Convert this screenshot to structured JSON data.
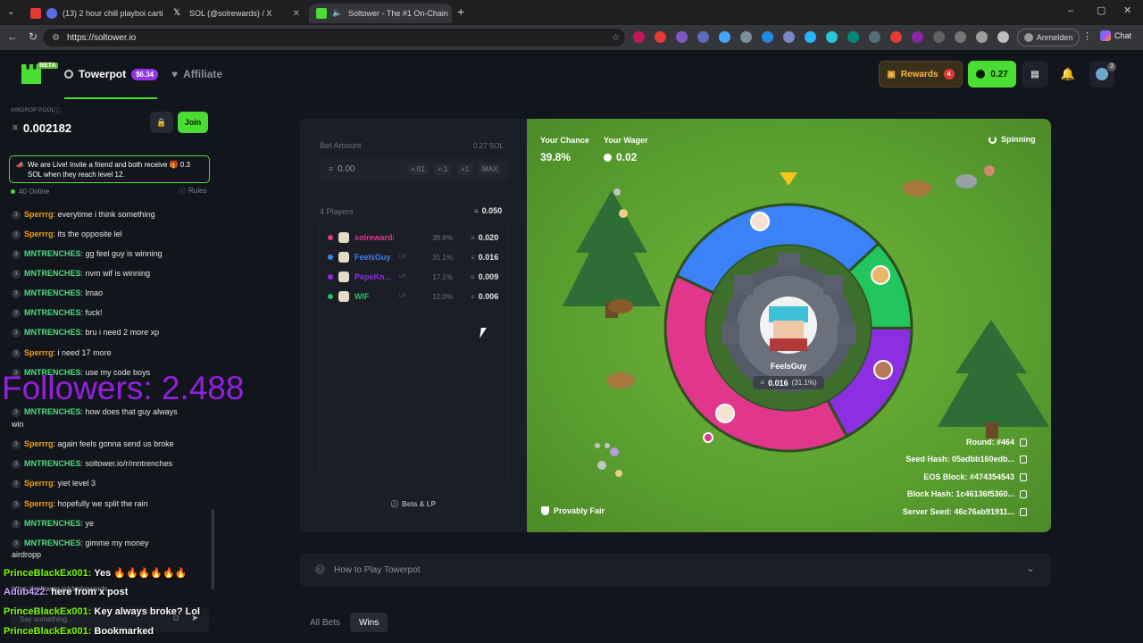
{
  "browser": {
    "tabs": [
      {
        "title": "(13) 2 hour chill playboi carti"
      },
      {
        "title": "SOL (@solrewards) / X"
      },
      {
        "title": "Soltower - The #1 On-Chain"
      }
    ],
    "url": "https://soltower.io",
    "profile_label": "Anmelden",
    "chat_label": "Chat"
  },
  "nav": {
    "beta": "BETA",
    "towerpot_label": "Towerpot",
    "towerpot_badge": "$6.34",
    "affiliate_label": "Affiliate",
    "rewards_label": "Rewards",
    "rewards_count": "4",
    "balance": "0.27",
    "notif_count": "3"
  },
  "sidebar": {
    "airdrop_label": "AIRDROP POOL",
    "airdrop_value": "0.002182",
    "join_label": "Join",
    "announcement": "We are Live! Invite a friend and both receive 🎁 0.3 SOL when they reach level 12.",
    "online": "40 Online",
    "rules": "Rules",
    "chat": [
      {
        "level": "3",
        "user": "Sperrrg",
        "color": "orange",
        "text": "everytime i think something"
      },
      {
        "level": "3",
        "user": "Sperrrg",
        "color": "orange",
        "text": "its the opposite lel"
      },
      {
        "level": "3",
        "user": "MNTRENCHES",
        "color": "green",
        "text": "gg feel guy is winning"
      },
      {
        "level": "3",
        "user": "MNTRENCHES",
        "color": "green",
        "text": "nvm wif is winning"
      },
      {
        "level": "3",
        "user": "MNTRENCHES",
        "color": "green",
        "text": "lmao"
      },
      {
        "level": "3",
        "user": "MNTRENCHES",
        "color": "green",
        "text": "fuck!"
      },
      {
        "level": "3",
        "user": "MNTRENCHES",
        "color": "green",
        "text": "bru i need 2 more xp"
      },
      {
        "level": "3",
        "user": "Sperrrg",
        "color": "orange",
        "text": "i need 17 more"
      },
      {
        "level": "3",
        "user": "MNTRENCHES",
        "color": "green",
        "text": "use my code boys"
      },
      {
        "level": "3",
        "user": "MNTRENCHES",
        "color": "green",
        "text": "how does that guy always"
      },
      {
        "level": "3",
        "user": "Sperrrg",
        "color": "orange",
        "text": "again feels gonna send us broke"
      },
      {
        "level": "3",
        "user": "MNTRENCHES",
        "color": "green",
        "text": "soltower.io/r/mntrenches"
      },
      {
        "level": "3",
        "user": "Sperrrg",
        "color": "orange",
        "text": "yiet level 3"
      },
      {
        "level": "3",
        "user": "Sperrrg",
        "color": "orange",
        "text": "hopefully we split the rain"
      },
      {
        "level": "3",
        "user": "MNTRENCHES",
        "color": "green",
        "text": "ye"
      },
      {
        "level": "3",
        "user": "MNTRENCHES",
        "color": "green",
        "text": "gimme my money"
      }
    ],
    "wrap_win": "win",
    "wrap_airdrop": "airdropp",
    "chat_link": "https://soltower.io/r/solrewards",
    "chat_placeholder": "Say something..."
  },
  "overlay": {
    "followers": "Followers: 2.488",
    "lines": [
      {
        "user": "PrinceBlackEx001:",
        "text": "Yes 🔥🔥🔥🔥🔥🔥"
      },
      {
        "user": "Adub422:",
        "text": "here from x post"
      },
      {
        "user": "PrinceBlackEx001:",
        "text": "Key always broke? Lol"
      },
      {
        "user": "PrinceBlackEx001:",
        "text": "Bookmarked"
      }
    ]
  },
  "bet": {
    "amount_label": "Bet Amount",
    "balance": "0.27 SOL",
    "amount_value": "0.00",
    "btn_p001": "+.01",
    "btn_p1a": "+.1",
    "btn_p1b": "+1",
    "btn_max": "MAX",
    "players_label": "4 Players",
    "pot": "0.050",
    "players": [
      {
        "name": "solrewards",
        "pct": "39.8%",
        "amount": "0.020",
        "color": "#e0368b",
        "tag": ""
      },
      {
        "name": "FeelsGuy",
        "pct": "31.1%",
        "amount": "0.016",
        "color": "#3b82f6",
        "tag": "LP"
      },
      {
        "name": "PepeKn...",
        "pct": "17.1%",
        "amount": "0.009",
        "color": "#8b2fe0",
        "tag": "LP"
      },
      {
        "name": "WIF",
        "pct": "12.0%",
        "amount": "0.006",
        "color": "#22c55e",
        "tag": "LP"
      }
    ],
    "footer": "Beta & LP"
  },
  "game": {
    "chance_label": "Your Chance",
    "chance_value": "39.8%",
    "wager_label": "Your Wager",
    "wager_value": "0.02",
    "status": "Spinning",
    "center_name": "FeelsGuy",
    "center_amount": "0.016",
    "center_pct": "(31.1%)",
    "provably_fair": "Provably Fair",
    "round_label": "Round:",
    "round_value": "#464",
    "seed_label": "Seed Hash:",
    "seed_value": "05adbb160edb...",
    "eos_label": "EOS Block:",
    "eos_value": "#474354543",
    "block_label": "Block Hash:",
    "block_value": "1c46136f5360...",
    "server_label": "Server Seed:",
    "server_value": "46c76ab91911...",
    "colors": {
      "blue": "#3b82f6",
      "green": "#22c55e",
      "purple": "#8b2fe0",
      "pink": "#e0368b"
    }
  },
  "howto": {
    "label": "How to Play Towerpot"
  },
  "bottom_tabs": {
    "all": "All Bets",
    "wins": "Wins"
  }
}
